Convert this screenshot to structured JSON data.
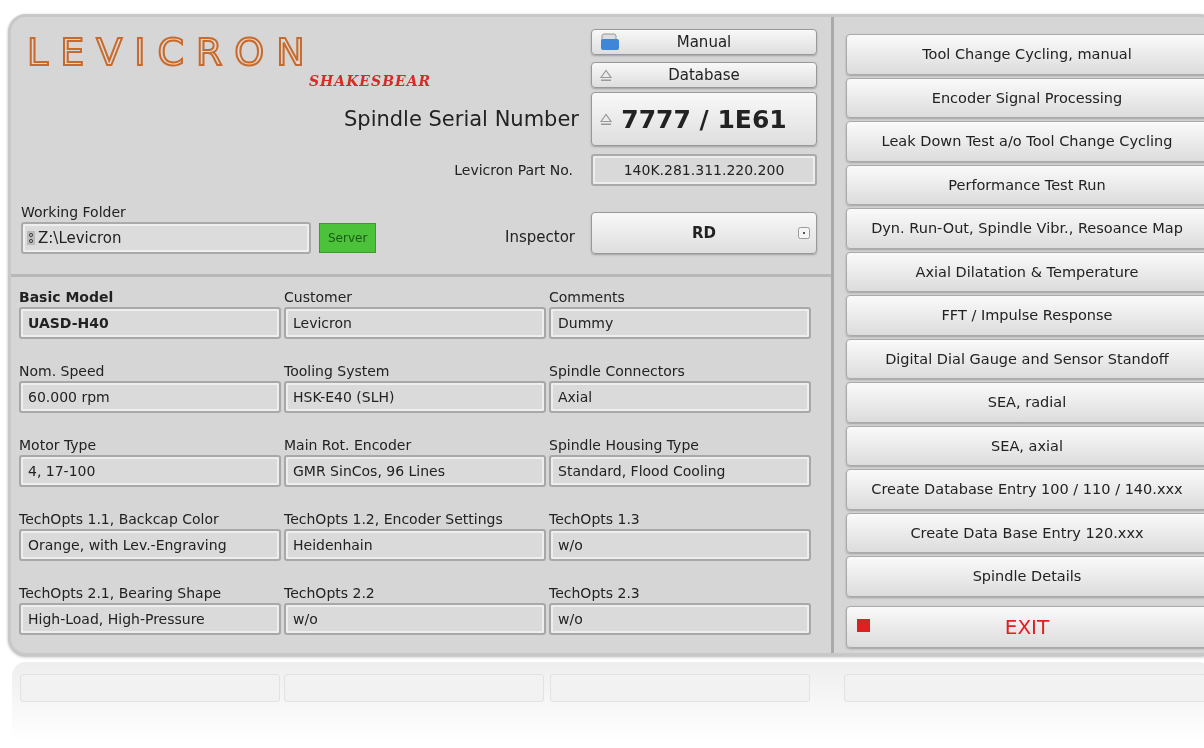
{
  "logo": {
    "wordmark": "LEVICRON",
    "signature": "SHAKESBEAR"
  },
  "header": {
    "manual_button": "Manual",
    "database_button": "Database",
    "serial_label": "Spindle Serial Number",
    "serial_value": "7777 / 1E61",
    "part_label": "Levicron Part No.",
    "part_value": "140K.281.311.220.200",
    "working_folder": {
      "label": "Working Folder",
      "value": "Z:\\Levicron"
    },
    "server_button": {
      "label": "Server",
      "on": true
    },
    "inspector": {
      "label": "Inspector",
      "value": "RD"
    }
  },
  "fields": [
    {
      "label": "Basic Model",
      "value": "UASD-H40",
      "emphasis": true
    },
    {
      "label": "Customer",
      "value": "Levicron",
      "emphasis": false
    },
    {
      "label": "Comments",
      "value": "Dummy",
      "emphasis": false
    },
    {
      "label": "Nom. Speed",
      "value": "60.000 rpm",
      "emphasis": false
    },
    {
      "label": "Tooling System",
      "value": "HSK-E40 (SLH)",
      "emphasis": false
    },
    {
      "label": "Spindle Connectors",
      "value": "Axial",
      "emphasis": false
    },
    {
      "label": "Motor Type",
      "value": "4, 17-100",
      "emphasis": false
    },
    {
      "label": "Main Rot. Encoder",
      "value": "GMR SinCos, 96 Lines",
      "emphasis": false
    },
    {
      "label": "Spindle Housing Type",
      "value": "Standard, Flood Cooling",
      "emphasis": false
    },
    {
      "label": "TechOpts 1.1, Backcap Color",
      "value": "Orange, with Lev.-Engraving",
      "emphasis": false
    },
    {
      "label": "TechOpts 1.2, Encoder Settings",
      "value": "Heidenhain",
      "emphasis": false
    },
    {
      "label": "TechOpts 1.3",
      "value": "w/o",
      "emphasis": false
    },
    {
      "label": "TechOpts 2.1, Bearing Shape",
      "value": "High-Load, High-Pressure",
      "emphasis": false
    },
    {
      "label": "TechOpts 2.2",
      "value": "w/o",
      "emphasis": false
    },
    {
      "label": "TechOpts 2.3",
      "value": "w/o",
      "emphasis": false
    }
  ],
  "actions": [
    {
      "label": "Tool Change Cycling, manual",
      "kind": "normal"
    },
    {
      "label": "Encoder Signal Processing",
      "kind": "normal"
    },
    {
      "label": "Leak Down Test a/o Tool Change Cycling",
      "kind": "normal"
    },
    {
      "label": "Performance Test Run",
      "kind": "normal"
    },
    {
      "label": "Dyn. Run-Out, Spindle Vibr., Resoance Map",
      "kind": "normal"
    },
    {
      "label": "Axial Dilatation & Temperature",
      "kind": "normal"
    },
    {
      "label": "FFT / Impulse Response",
      "kind": "normal"
    },
    {
      "label": "Digital Dial Gauge and Sensor Standoff",
      "kind": "normal"
    },
    {
      "label": "SEA, radial",
      "kind": "normal"
    },
    {
      "label": "SEA, axial",
      "kind": "normal"
    },
    {
      "label": "Create Database Entry 100 / 110 / 140.xxx",
      "kind": "normal"
    },
    {
      "label": "Create Data Base Entry 120.xxx",
      "kind": "normal"
    },
    {
      "label": "Spindle Details",
      "kind": "normal"
    },
    {
      "label": "EXIT",
      "kind": "exit"
    }
  ]
}
